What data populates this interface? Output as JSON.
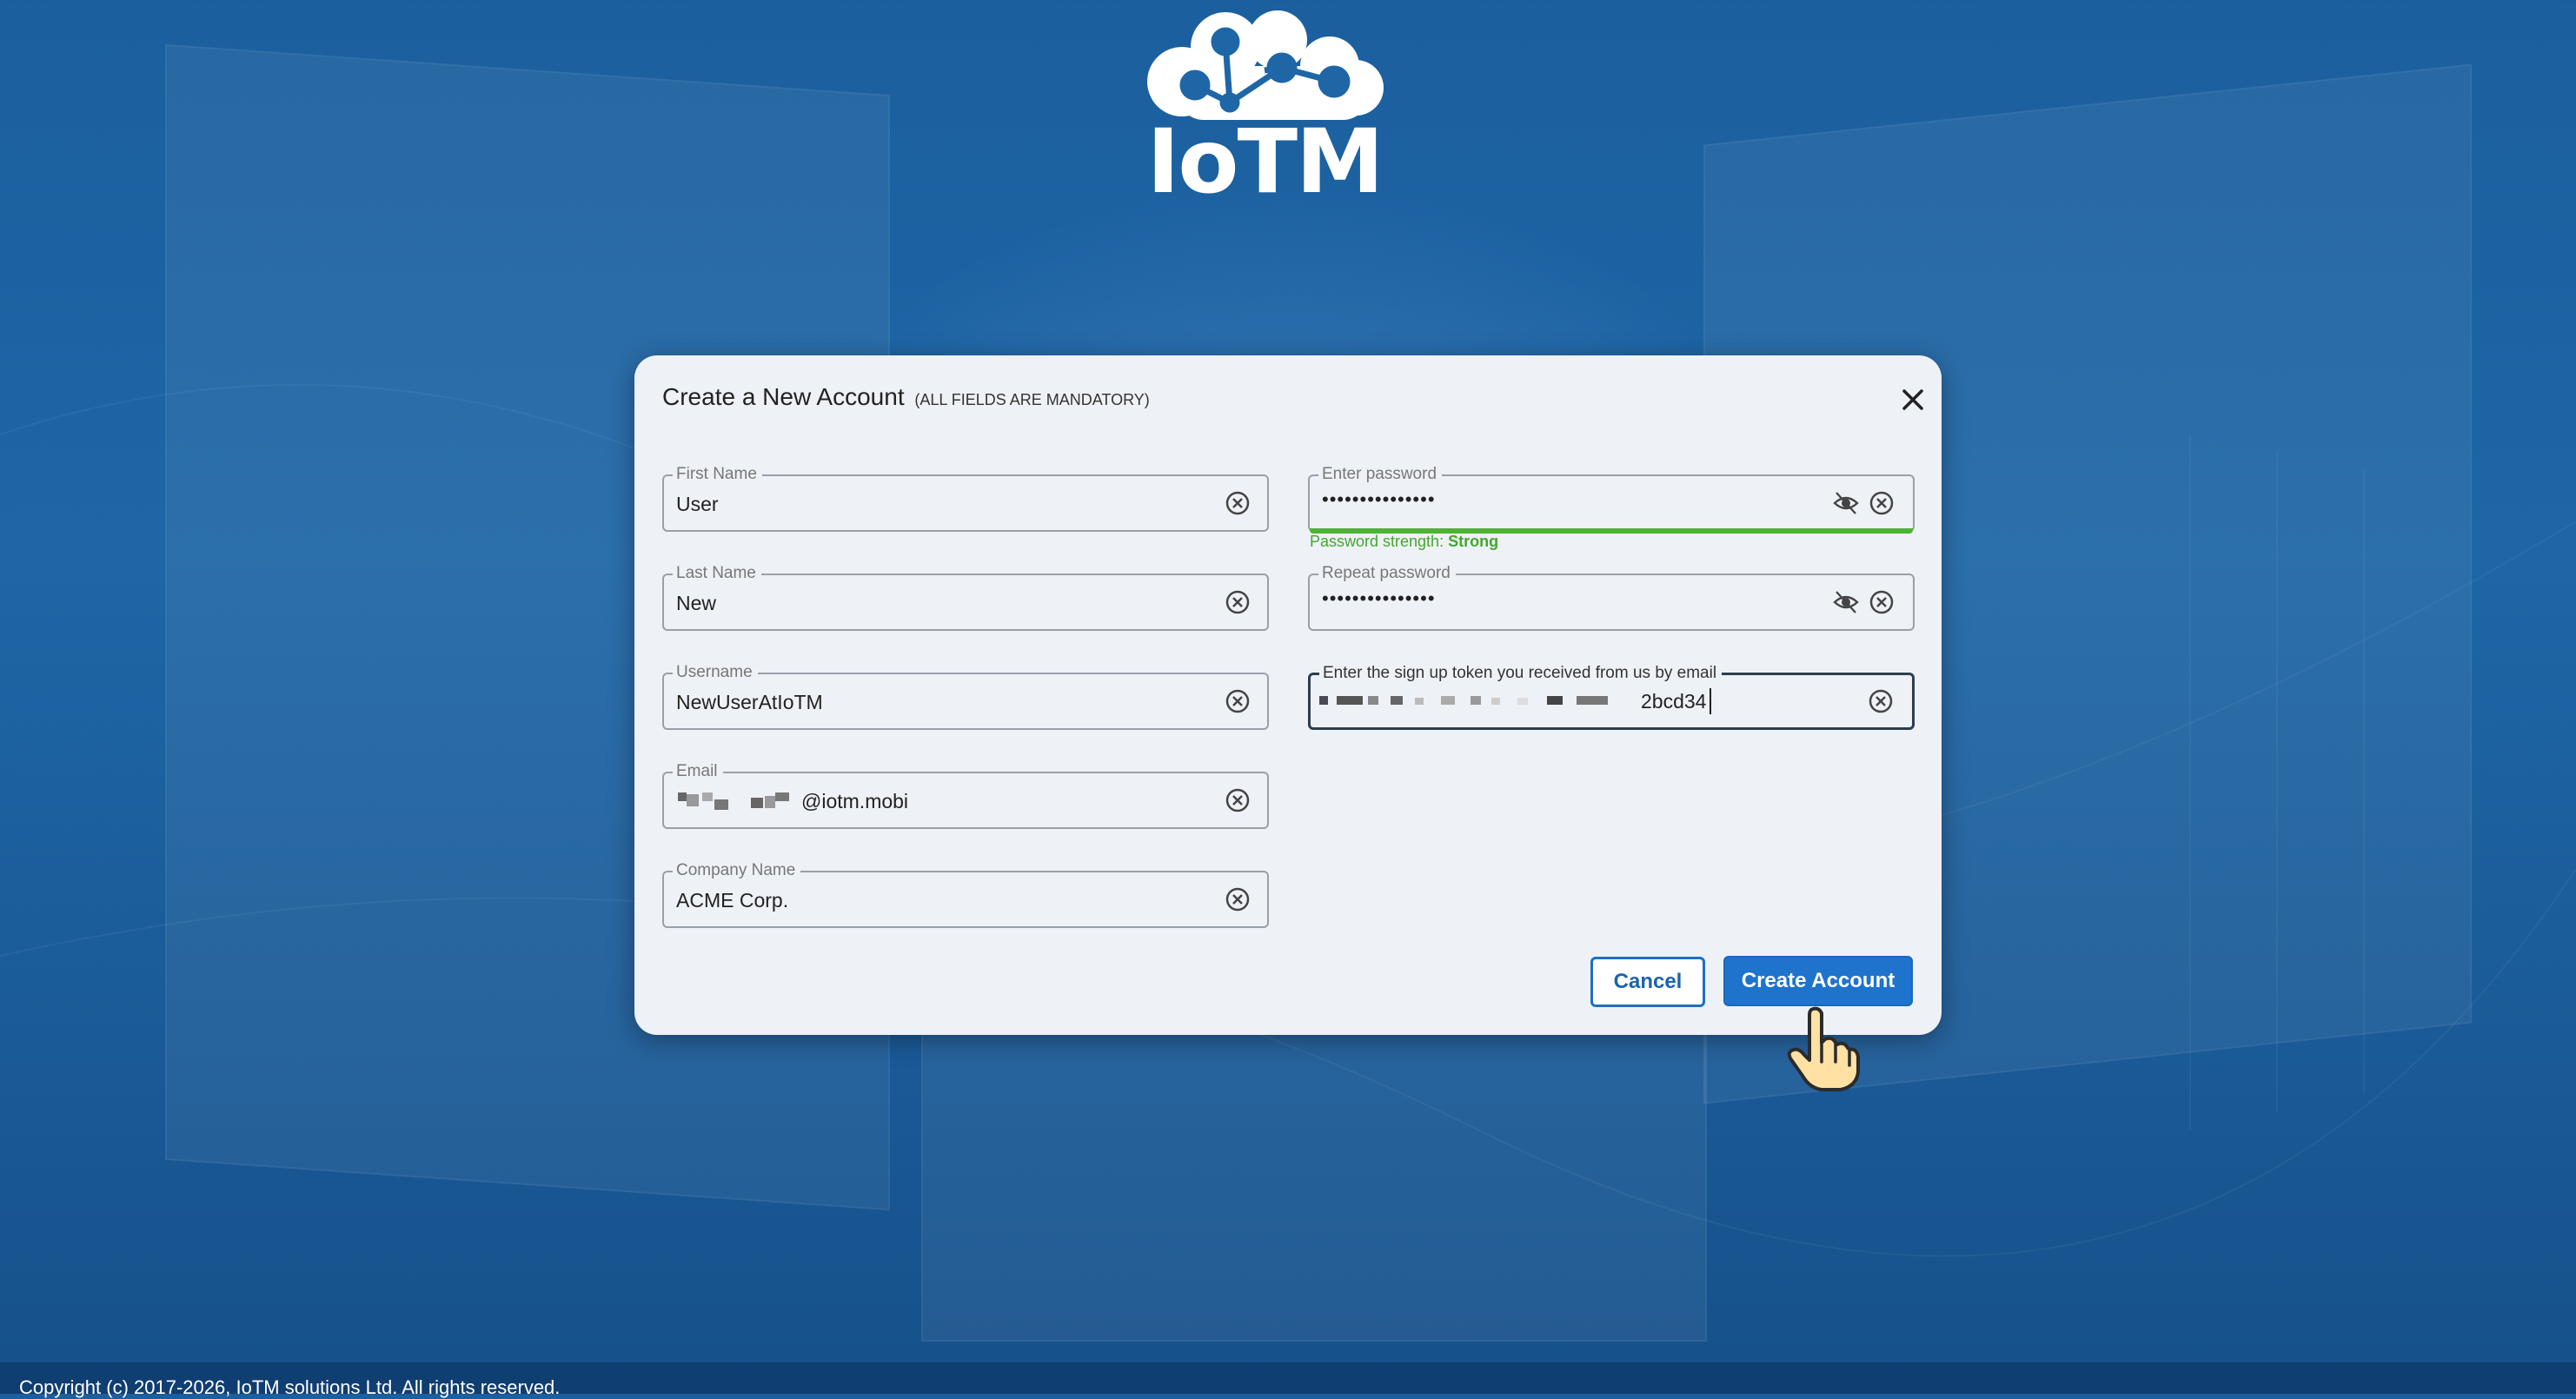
{
  "brand": {
    "logo_text": "IoTM"
  },
  "dialog": {
    "title": "Create a New Account",
    "subtitle": "(ALL FIELDS ARE MANDATORY)",
    "close_icon": "close-icon"
  },
  "form": {
    "first_name": {
      "label": "First Name",
      "value": "User"
    },
    "last_name": {
      "label": "Last Name",
      "value": "New"
    },
    "username": {
      "label": "Username",
      "value": "NewUserAtIoTM"
    },
    "email": {
      "label": "Email",
      "value_visible_suffix": "@iotm.mobi"
    },
    "company": {
      "label": "Company Name",
      "value": "ACME Corp."
    },
    "password": {
      "label": "Enter password",
      "value": "•••••••••••••••",
      "strength_label": "Password strength:",
      "strength_value": "Strong"
    },
    "repeat_password": {
      "label": "Repeat password",
      "value": "•••••••••••••••"
    },
    "token": {
      "label": "Enter the sign up token you received from us by email",
      "value_visible_suffix": "2bcd34"
    }
  },
  "buttons": {
    "cancel": "Cancel",
    "create": "Create Account"
  },
  "footer": {
    "copyright": "Copyright (c) 2017-2026, IoTM solutions Ltd. All rights reserved."
  },
  "colors": {
    "accent": "#1e73cd",
    "strength": "#4fb236",
    "background": "#1e66a6"
  }
}
